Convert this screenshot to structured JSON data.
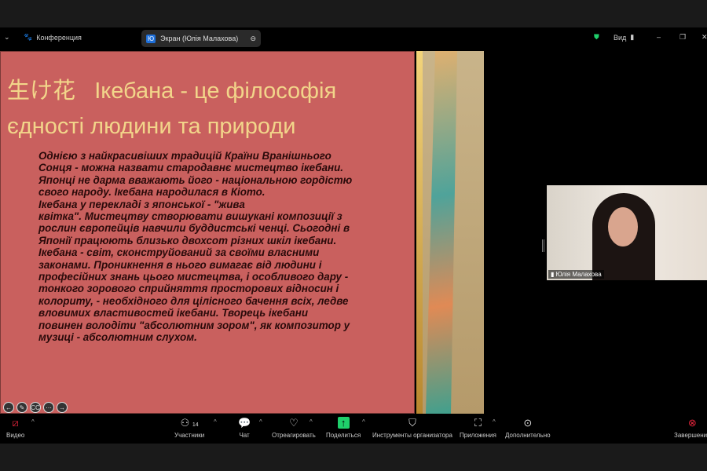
{
  "topbar": {
    "meeting_label": "Конференция",
    "screen_tab": "Экран (Юлія Малахова)",
    "badge": "Ю",
    "view_label": "Вид"
  },
  "slide": {
    "title_jp": "生け花",
    "title_line1": "Ікебана - це філософія",
    "title_line2": "єдності людини та природи",
    "body_lines": [
      "Однією з найкрасивіших традицій Країни Вранішнього",
      "Сонця - можна назвати стародавнє мистецтво ікебани.",
      "Японці не дарма вважають його - національною гордістю",
      "свого народу. Ікебана народилася в Кіото.",
      "Ікебана у перекладі з японської - \"жива",
      "квітка\". Мистецтву створювати вишукані композиції з",
      "рослин європейців навчили буддистські ченці. Сьогодні в",
      "Японії працюють близько двохсот різних шкіл ікебани.",
      "Ікебана - світ, сконструйований за своїми власними",
      "законами. Проникнення в нього вимагає від людини і",
      "професійних знань цього мистецтва, і особливого дару -",
      "тонкого зорового сприйняття просторових відносин і",
      "колориту, - необхідного для цілісного бачення всіх, ледве",
      "вловимих властивостей ікебани. Творець ікебани",
      "повинен володіти \"абсолютним зором\", як композитор у",
      "музиці - абсолютним слухом."
    ],
    "controls": [
      "←",
      "✎",
      "CC",
      "⋯",
      "→"
    ]
  },
  "video": {
    "name": "Юлія Малахова"
  },
  "toolbar": {
    "video": "Видео",
    "participants": "Участники",
    "participants_count": "14",
    "chat": "Чат",
    "react": "Отреагировать",
    "share": "Поделиться",
    "host_tools": "Инструменты организатора",
    "apps": "Приложения",
    "more": "Дополнительно",
    "end": "Завершение"
  },
  "colors": {
    "slide_bg": "#c9605e",
    "title": "#f2d58a",
    "share": "#1fcf6b",
    "end": "#e0243a"
  }
}
